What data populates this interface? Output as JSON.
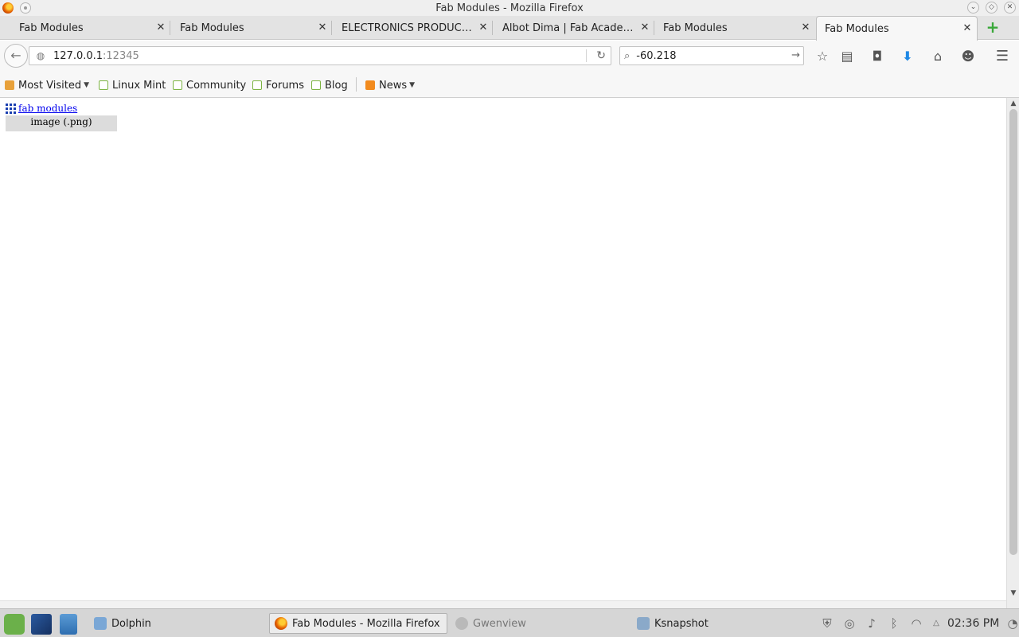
{
  "window": {
    "title": "Fab Modules - Mozilla Firefox"
  },
  "tabs": [
    {
      "label": "Fab Modules",
      "active": false
    },
    {
      "label": "Fab Modules",
      "active": false
    },
    {
      "label": "ELECTRONICS PRODUCTI...",
      "active": false
    },
    {
      "label": "Albot Dima | Fab Academ...",
      "active": false
    },
    {
      "label": "Fab Modules",
      "active": false
    },
    {
      "label": "Fab Modules",
      "active": true
    }
  ],
  "navbar": {
    "url_host": "127.0.0.1",
    "url_port": ":12345",
    "search_value": "-60.218"
  },
  "bookmarks": [
    {
      "label": "Most Visited",
      "icon": "folder-icon",
      "dropdown": true
    },
    {
      "label": "Linux Mint",
      "icon": "mint-icon",
      "dropdown": false
    },
    {
      "label": "Community",
      "icon": "mint-icon",
      "dropdown": false
    },
    {
      "label": "Forums",
      "icon": "mint-icon",
      "dropdown": false
    },
    {
      "label": "Blog",
      "icon": "mint-icon",
      "dropdown": false
    },
    {
      "label": "News",
      "icon": "rss-icon",
      "dropdown": true
    }
  ],
  "page": {
    "link_text": "fab modules",
    "menu_item": "image (.png)"
  },
  "taskbar": {
    "tasks": [
      {
        "label": "Dolphin",
        "state": "normal"
      },
      {
        "label": "Fab Modules - Mozilla Firefox",
        "state": "active"
      },
      {
        "label": "Gwenview",
        "state": "dim"
      },
      {
        "label": "Ksnapshot",
        "state": "normal"
      }
    ],
    "clock": "02:36 PM"
  },
  "colors": {
    "link": "#0000ee",
    "menu_item_bg": "#dcdcdc",
    "download_arrow": "#1e88e5",
    "new_tab_plus": "#3aa83a"
  }
}
